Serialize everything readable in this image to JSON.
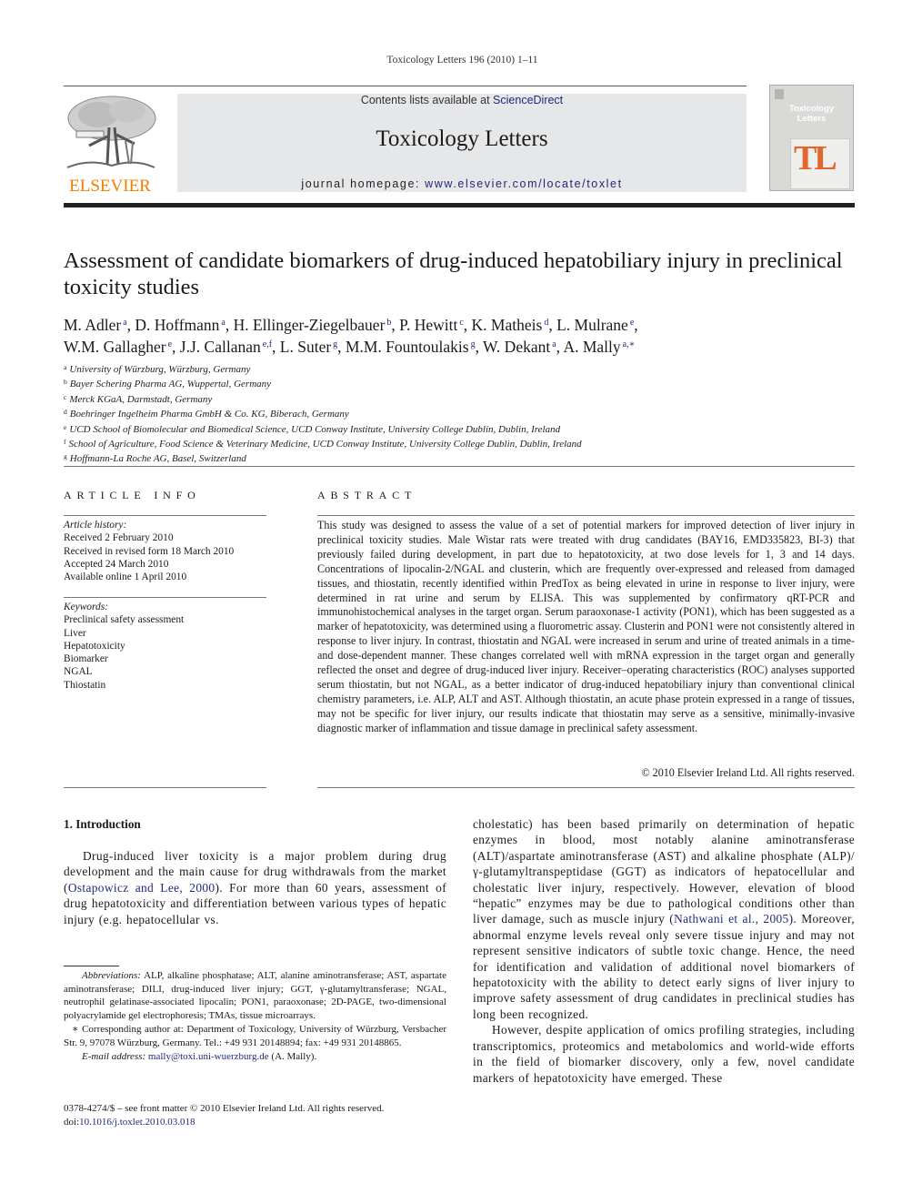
{
  "running_header": "Toxicology Letters 196 (2010) 1–11",
  "banner": {
    "publisher_logo": "ELSEVIER",
    "contents_prefix": "Contents lists available at ",
    "contents_link": "ScienceDirect",
    "journal_title": "Toxicology Letters",
    "homepage_prefix": "journal homepage: ",
    "homepage_url": "www.elsevier.com/locate/toxlet",
    "cover": {
      "title_line1": "Toxicology",
      "title_line2": "Letters",
      "monogram": "TL"
    },
    "colors": {
      "publisher_orange": "#f07d00",
      "link_blue": "#1f2a7a",
      "band_gray": "#e6e7e9",
      "cover_tl": "#e0662c"
    }
  },
  "article": {
    "title": "Assessment of candidate biomarkers of drug-induced hepatobiliary injury in preclinical toxicity studies",
    "authors": [
      {
        "name": "M. Adler",
        "aff": "a",
        "sep": ", "
      },
      {
        "name": "D. Hoffmann",
        "aff": "a",
        "sep": ", "
      },
      {
        "name": "H. Ellinger-Ziegelbauer",
        "aff": "b",
        "sep": ", "
      },
      {
        "name": "P. Hewitt",
        "aff": "c",
        "sep": ", "
      },
      {
        "name": "K. Matheis",
        "aff": "d",
        "sep": ", "
      },
      {
        "name": "L. Mulrane",
        "aff": "e",
        "sep": ","
      },
      {
        "name": "W.M. Gallagher",
        "aff": "e",
        "sep": ", "
      },
      {
        "name": "J.J. Callanan",
        "aff": "e,f",
        "sep": ", "
      },
      {
        "name": "L. Suter",
        "aff": "g",
        "sep": ", "
      },
      {
        "name": "M.M. Fountoulakis",
        "aff": "g",
        "sep": ", "
      },
      {
        "name": "W. Dekant",
        "aff": "a",
        "sep": ", "
      },
      {
        "name": "A. Mally",
        "aff": "a,∗",
        "sep": ""
      }
    ],
    "affiliations": [
      {
        "key": "a",
        "text": "University of Würzburg, Würzburg, Germany"
      },
      {
        "key": "b",
        "text": "Bayer Schering Pharma AG, Wuppertal, Germany"
      },
      {
        "key": "c",
        "text": "Merck KGaA, Darmstadt, Germany"
      },
      {
        "key": "d",
        "text": "Boehringer Ingelheim Pharma GmbH & Co. KG, Biberach, Germany"
      },
      {
        "key": "e",
        "text": "UCD School of Biomolecular and Biomedical Science, UCD Conway Institute, University College Dublin, Dublin, Ireland"
      },
      {
        "key": "f",
        "text": "School of Agriculture, Food Science & Veterinary Medicine, UCD Conway Institute, University College Dublin, Dublin, Ireland"
      },
      {
        "key": "g",
        "text": "Hoffmann-La Roche AG, Basel, Switzerland"
      }
    ]
  },
  "article_info": {
    "heading": "ARTICLE INFO",
    "history_label": "Article history:",
    "history": [
      "Received 2 February 2010",
      "Received in revised form 18 March 2010",
      "Accepted 24 March 2010",
      "Available online 1 April 2010"
    ],
    "keywords_label": "Keywords:",
    "keywords": [
      "Preclinical safety assessment",
      "Liver",
      "Hepatotoxicity",
      "Biomarker",
      "NGAL",
      "Thiostatin"
    ]
  },
  "abstract": {
    "heading": "ABSTRACT",
    "text": "This study was designed to assess the value of a set of potential markers for improved detection of liver injury in preclinical toxicity studies. Male Wistar rats were treated with drug candidates (BAY16, EMD335823, BI-3) that previously failed during development, in part due to hepatotoxicity, at two dose levels for 1, 3 and 14 days. Concentrations of lipocalin-2/NGAL and clusterin, which are frequently over-expressed and released from damaged tissues, and thiostatin, recently identified within PredTox as being elevated in urine in response to liver injury, were determined in rat urine and serum by ELISA. This was supplemented by confirmatory qRT-PCR and immunohistochemical analyses in the target organ. Serum paraoxonase-1 activity (PON1), which has been suggested as a marker of hepatotoxicity, was determined using a fluorometric assay. Clusterin and PON1 were not consistently altered in response to liver injury. In contrast, thiostatin and NGAL were increased in serum and urine of treated animals in a time- and dose-dependent manner. These changes correlated well with mRNA expression in the target organ and generally reflected the onset and degree of drug-induced liver injury. Receiver–operating characteristics (ROC) analyses supported serum thiostatin, but not NGAL, as a better indicator of drug-induced hepato­biliary injury than conventional clinical chemistry parameters, i.e. ALP, ALT and AST. Although thiostatin, an acute phase protein expressed in a range of tissues, may not be specific for liver injury, our results indicate that thiostatin may serve as a sensitive, minimally-invasive diagnostic marker of inflammation and tissue damage in preclinical safety assessment.",
    "copyright": "© 2010 Elsevier Ireland Ltd. All rights reserved."
  },
  "introduction": {
    "heading": "1.  Introduction",
    "left_p1_a": "Drug-induced liver toxicity is a major problem during drug development and the main cause for drug withdrawals from the market (",
    "left_p1_cite": "Ostapowicz and Lee, 2000",
    "left_p1_b": "). For more than 60 years, assessment of drug hepatotoxicity and differentiation between various types of hepatic injury (e.g. hepatocellular vs.",
    "right_p1_a": "cholestatic) has been based primarily on determination of hep­atic enzymes in blood, most notably alanine aminotransferase (ALT)/aspartate aminotransferase (AST) and alkaline phosphate (ALP)/γ-glutamyltranspeptidase (GGT) as indicators of hepatocel­lular and cholestatic liver injury, respectively. However, elevation of blood “hepatic” enzymes may be due to pathological conditions other than liver damage, such as muscle injury (",
    "right_p1_cite": "Nathwani et al., 2005",
    "right_p1_b": "). Moreover, abnormal enzyme levels reveal only severe tis­sue injury and may not represent sensitive indicators of subtle toxic change. Hence, the need for identification and validation of additional novel biomarkers of hepatotoxicity with the ability to detect early signs of liver injury to improve safety assessment of drug candidates in preclinical studies has long been recognized.",
    "right_p2": "However, despite application of omics profiling strategies, including transcriptomics, proteomics and metabolomics and world-wide efforts in the field of biomarker discovery, only a few, novel candidate markers of hepatotoxicity have emerged. These"
  },
  "footnotes": {
    "abbr_label": "Abbreviations:",
    "abbr_text": "  ALP, alkaline phosphatase; ALT, alanine aminotransferase; AST, aspartate aminotransferase; DILI, drug-induced liver injury; GGT, γ-glutamyltransferase; NGAL, neutrophil gelatinase-associated lipocalin; PON1, paraoxonase; 2D-PAGE, two-dimensional polyacrylamide gel electrophoresis; TMAs, tissue microarrays.",
    "corresponding": "∗ Corresponding author at: Department of Toxicology, University of Würzburg, Versbacher Str. 9, 97078 Würzburg, Germany. Tel.: +49 931 20148894; fax: +49 931 20148865.",
    "email_label": "E-mail address:",
    "email": "mally@toxi.uni-wuerzburg.de",
    "email_suffix": " (A. Mally)."
  },
  "bottom": {
    "issn_line": "0378-4274/$ – see front matter © 2010 Elsevier Ireland Ltd. All rights reserved.",
    "doi_prefix": "doi:",
    "doi": "10.1016/j.toxlet.2010.03.018"
  }
}
